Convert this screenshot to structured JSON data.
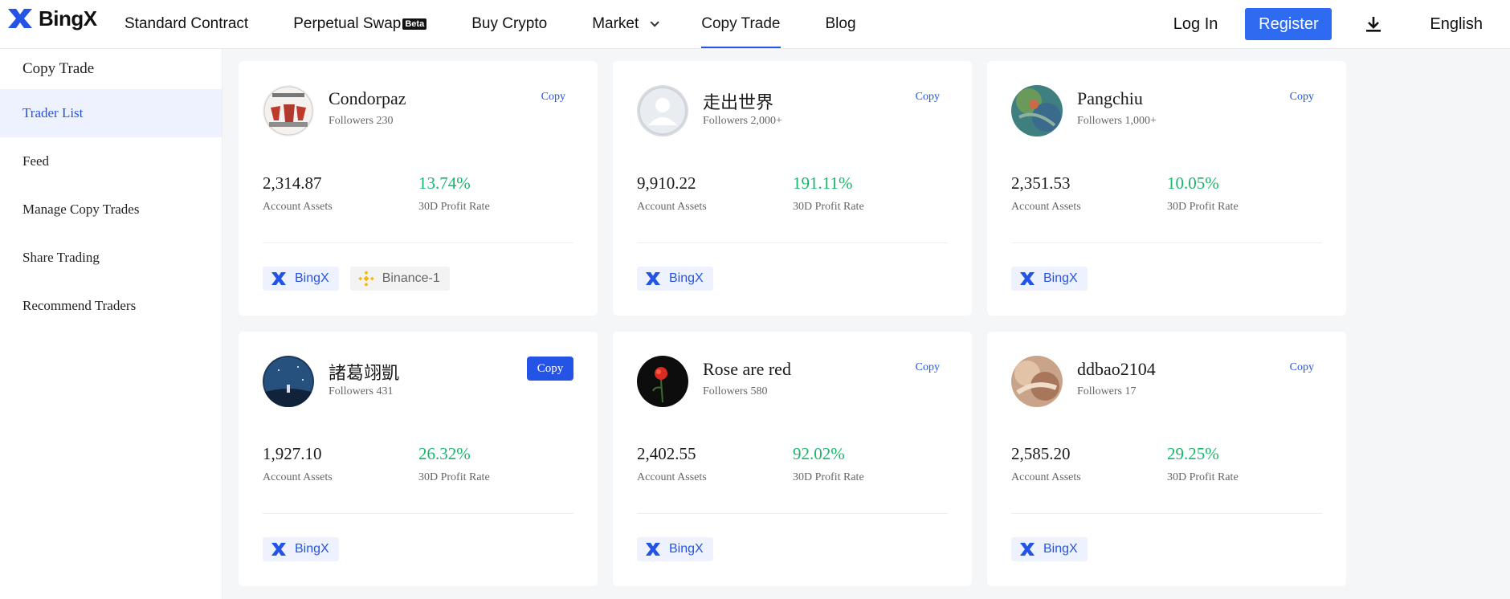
{
  "header": {
    "logo_text": "BingX",
    "nav": [
      {
        "label": "Standard Contract"
      },
      {
        "label": "Perpetual Swap",
        "badge": "Beta"
      },
      {
        "label": "Buy Crypto"
      },
      {
        "label": "Market"
      },
      {
        "label": "Copy Trade"
      },
      {
        "label": "Blog"
      }
    ],
    "login": "Log In",
    "register": "Register",
    "language": "English"
  },
  "sidebar": {
    "items": [
      {
        "label": "Copy Trade"
      },
      {
        "label": "Trader List"
      },
      {
        "label": "Feed"
      },
      {
        "label": "Manage Copy Trades"
      },
      {
        "label": "Share Trading"
      },
      {
        "label": "Recommend Traders"
      }
    ]
  },
  "colors": {
    "accent": "#2354e6",
    "profit": "#14b86a",
    "binance": "#f0b90b"
  },
  "cards": [
    {
      "name": "Condorpaz",
      "followers": "Followers 230",
      "copy": "Copy",
      "assets": "2,314.87",
      "assets_label": "Account Assets",
      "profit": "13.74%",
      "profit_label": "30D Profit Rate",
      "tags": [
        "BingX",
        "Binance-1"
      ]
    },
    {
      "name": "走出世界",
      "followers": "Followers 2,000+",
      "copy": "Copy",
      "assets": "9,910.22",
      "assets_label": "Account Assets",
      "profit": "191.11%",
      "profit_label": "30D Profit Rate",
      "tags": [
        "BingX"
      ]
    },
    {
      "name": "Pangchiu",
      "followers": "Followers 1,000+",
      "copy": "Copy",
      "assets": "2,351.53",
      "assets_label": "Account Assets",
      "profit": "10.05%",
      "profit_label": "30D Profit Rate",
      "tags": [
        "BingX"
      ]
    },
    {
      "name": "諸葛翊凱",
      "followers": "Followers 431",
      "copy": "Copy",
      "assets": "1,927.10",
      "assets_label": "Account Assets",
      "profit": "26.32%",
      "profit_label": "30D Profit Rate",
      "tags": [
        "BingX"
      ]
    },
    {
      "name": "Rose are red",
      "followers": "Followers 580",
      "copy": "Copy",
      "assets": "2,402.55",
      "assets_label": "Account Assets",
      "profit": "92.02%",
      "profit_label": "30D Profit Rate",
      "tags": [
        "BingX"
      ]
    },
    {
      "name": "ddbao2104",
      "followers": "Followers 17",
      "copy": "Copy",
      "assets": "2,585.20",
      "assets_label": "Account Assets",
      "profit": "29.25%",
      "profit_label": "30D Profit Rate",
      "tags": [
        "BingX"
      ]
    }
  ]
}
